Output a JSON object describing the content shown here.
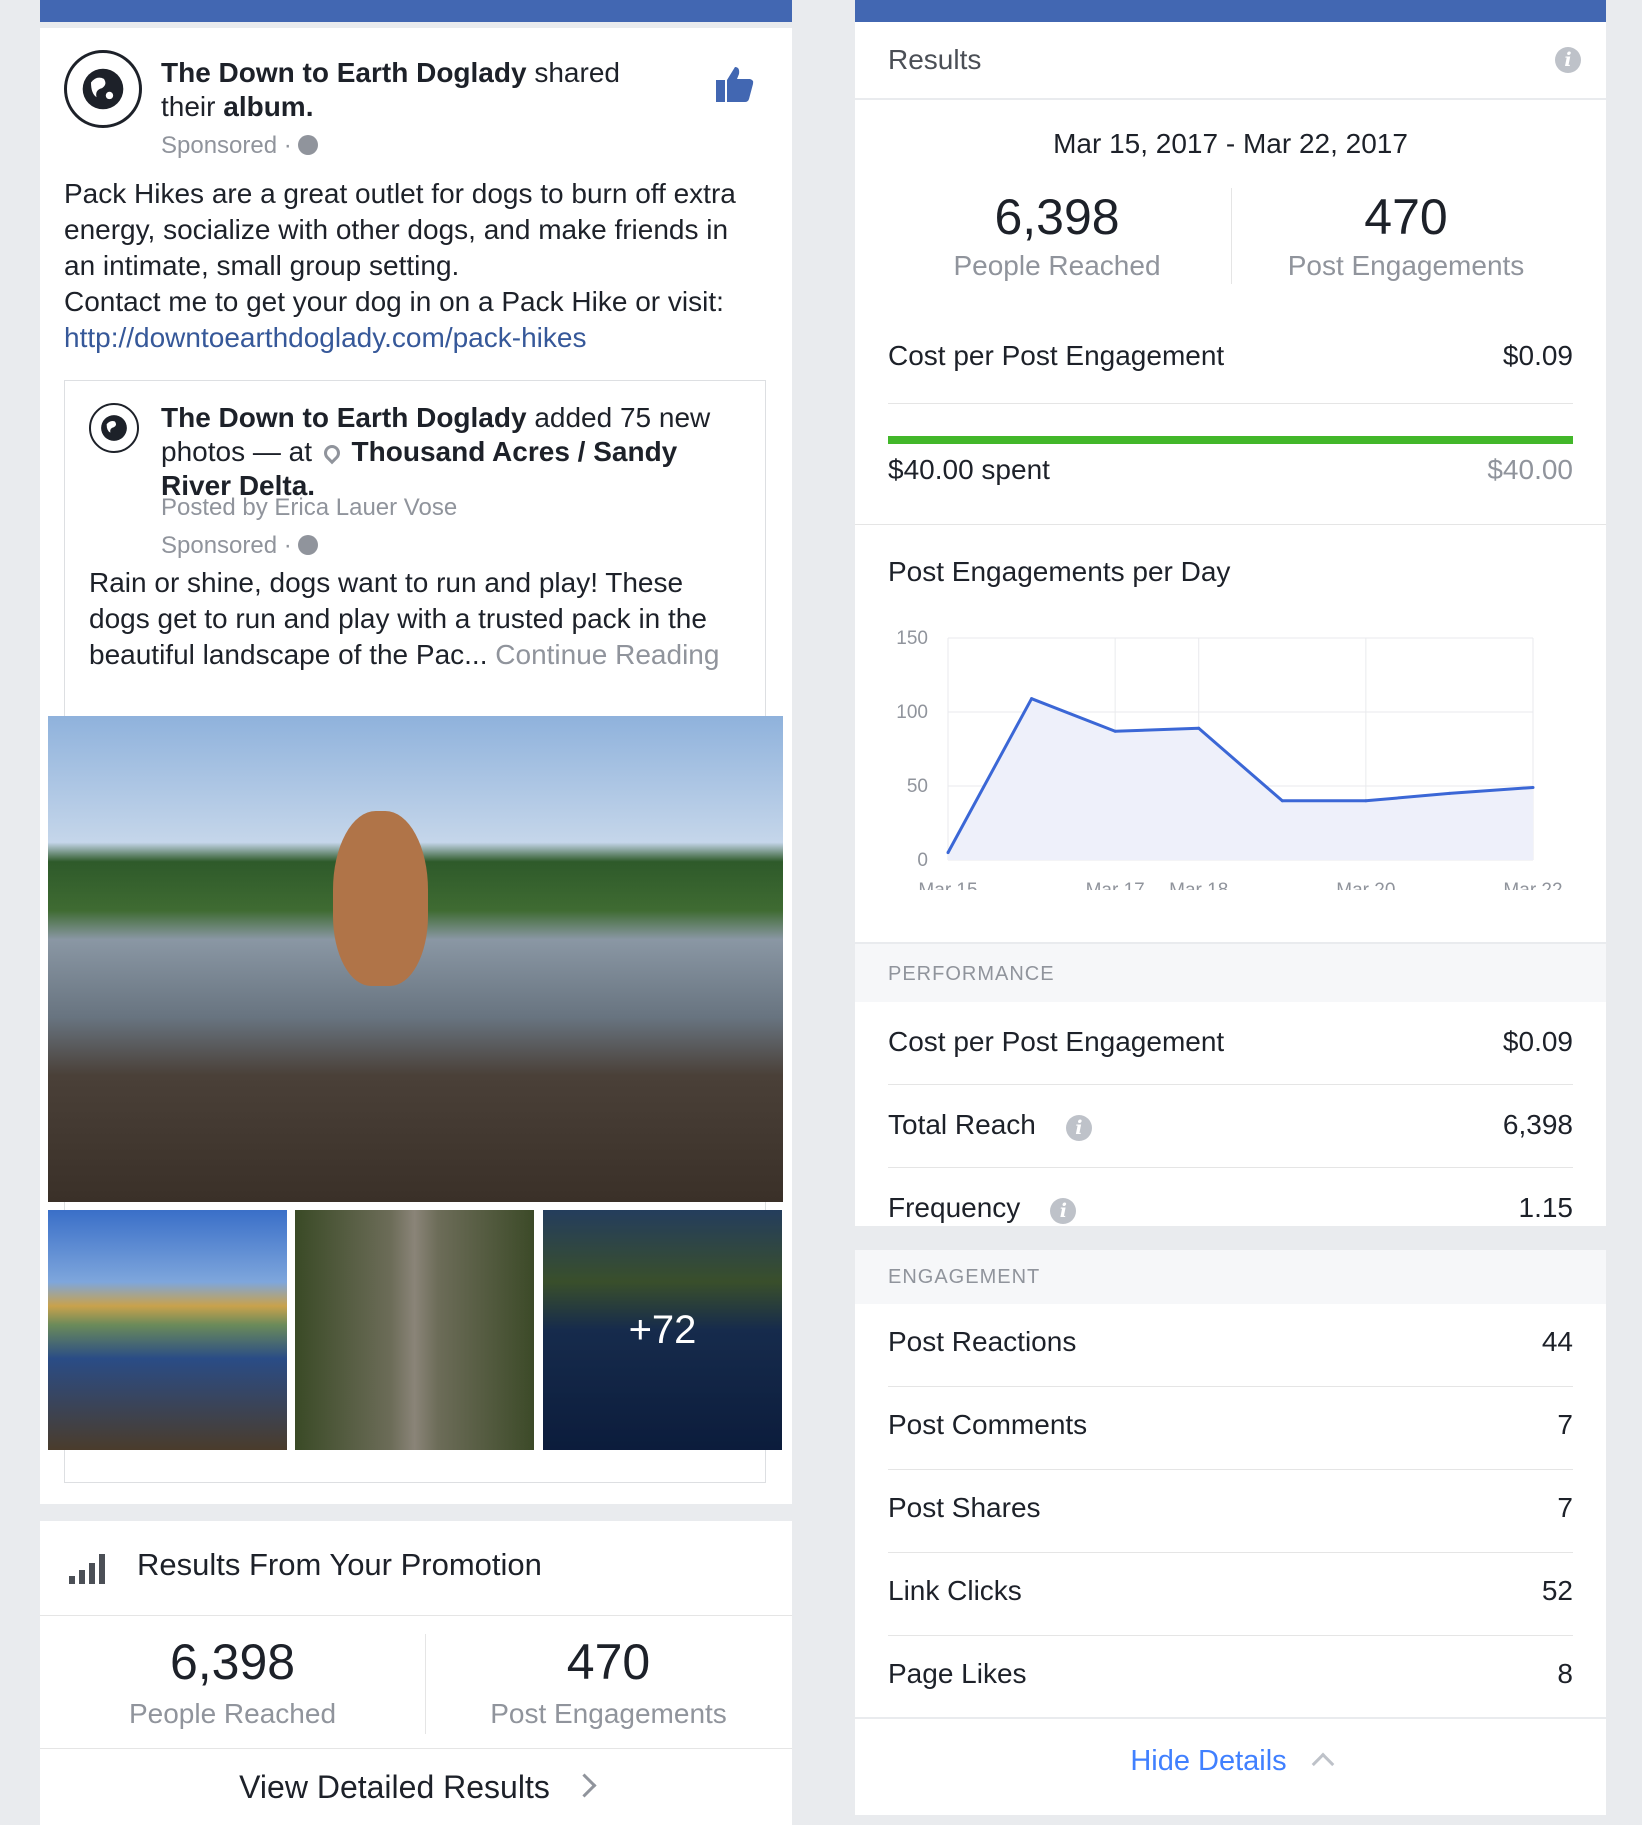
{
  "post": {
    "author": "The Down to Earth Doglady",
    "shared_text": "shared",
    "their_text": "their",
    "album_text": "album",
    "sponsored": "Sponsored ·",
    "body_lines": [
      "Pack Hikes are a great outlet for dogs to burn off extra",
      "energy, socialize with other dogs, and make friends in",
      "an intimate, small group setting.",
      "Contact me to get your dog in on a Pack Hike or visit:"
    ],
    "link": "http://downtoearthdoglady.com/pack-hikes",
    "inner": {
      "author": "The Down to Earth Doglady",
      "added_text": "added 75 new",
      "photos_text": "photos — at",
      "place_line1": "Thousand Acres / Sandy",
      "place_line2": "River Delta",
      "posted_by": "Posted by Erica Lauer Vose",
      "sponsored": "Sponsored ·",
      "body_lines": [
        "Rain or shine, dogs want to run and play! These",
        "dogs get to run and play with a trusted pack in the",
        "beautiful landscape of the Pac..."
      ],
      "continue": "Continue Reading",
      "more_photos": "+72"
    },
    "icons": {
      "like": "like-thumb-icon",
      "globe": "globe-icon",
      "pin": "location-pin-icon"
    }
  },
  "promotion": {
    "title": "Results From Your Promotion",
    "reached_value": "6,398",
    "reached_label": "People Reached",
    "engagements_value": "470",
    "engagements_label": "Post Engagements",
    "view_button": "View Detailed Results"
  },
  "results": {
    "title": "Results",
    "date_range": "Mar 15, 2017 - Mar 22, 2017",
    "reached_value": "6,398",
    "reached_label": "People Reached",
    "engagements_value": "470",
    "engagements_label": "Post Engagements",
    "cpe_label": "Cost per Post Engagement",
    "cpe_value": "$0.09",
    "spent_label": "$40.00 spent",
    "budget_value": "$40.00",
    "spent_fraction": 1.0,
    "progress_color": "#42b72a",
    "chart_title": "Post Engagements per Day",
    "performance_header": "PERFORMANCE",
    "performance": [
      {
        "label": "Cost per Post Engagement",
        "value": "$0.09",
        "info": false
      },
      {
        "label": "Total Reach",
        "value": "6,398",
        "info": true
      },
      {
        "label": "Frequency",
        "value": "1.15",
        "info": true
      }
    ],
    "engagement_header": "ENGAGEMENT",
    "engagement": [
      {
        "label": "Post Reactions",
        "value": "44"
      },
      {
        "label": "Post Comments",
        "value": "7"
      },
      {
        "label": "Post Shares",
        "value": "7"
      },
      {
        "label": "Link Clicks",
        "value": "52"
      },
      {
        "label": "Page Likes",
        "value": "8"
      }
    ],
    "hide_details": "Hide Details"
  },
  "chart_data": {
    "type": "area",
    "title": "Post Engagements per Day",
    "x": [
      "Mar 15",
      "Mar 16",
      "Mar 17",
      "Mar 18",
      "Mar 19",
      "Mar 20",
      "Mar 21",
      "Mar 22"
    ],
    "x_tick_labels": [
      "Mar 15",
      "Mar 17",
      "Mar 18",
      "Mar 20",
      "Mar 22"
    ],
    "series": [
      {
        "values": [
          5,
          109,
          87,
          89,
          40,
          40,
          45,
          49
        ]
      }
    ],
    "ylim": [
      0,
      150
    ],
    "y_ticks": [
      0,
      50,
      100,
      150
    ],
    "grid": true,
    "line_color": "#3b67d6",
    "fill_color": "#eef0fa"
  },
  "colors": {
    "brand": "#4267b2",
    "link": "#365899",
    "accent": "#4080ff"
  }
}
